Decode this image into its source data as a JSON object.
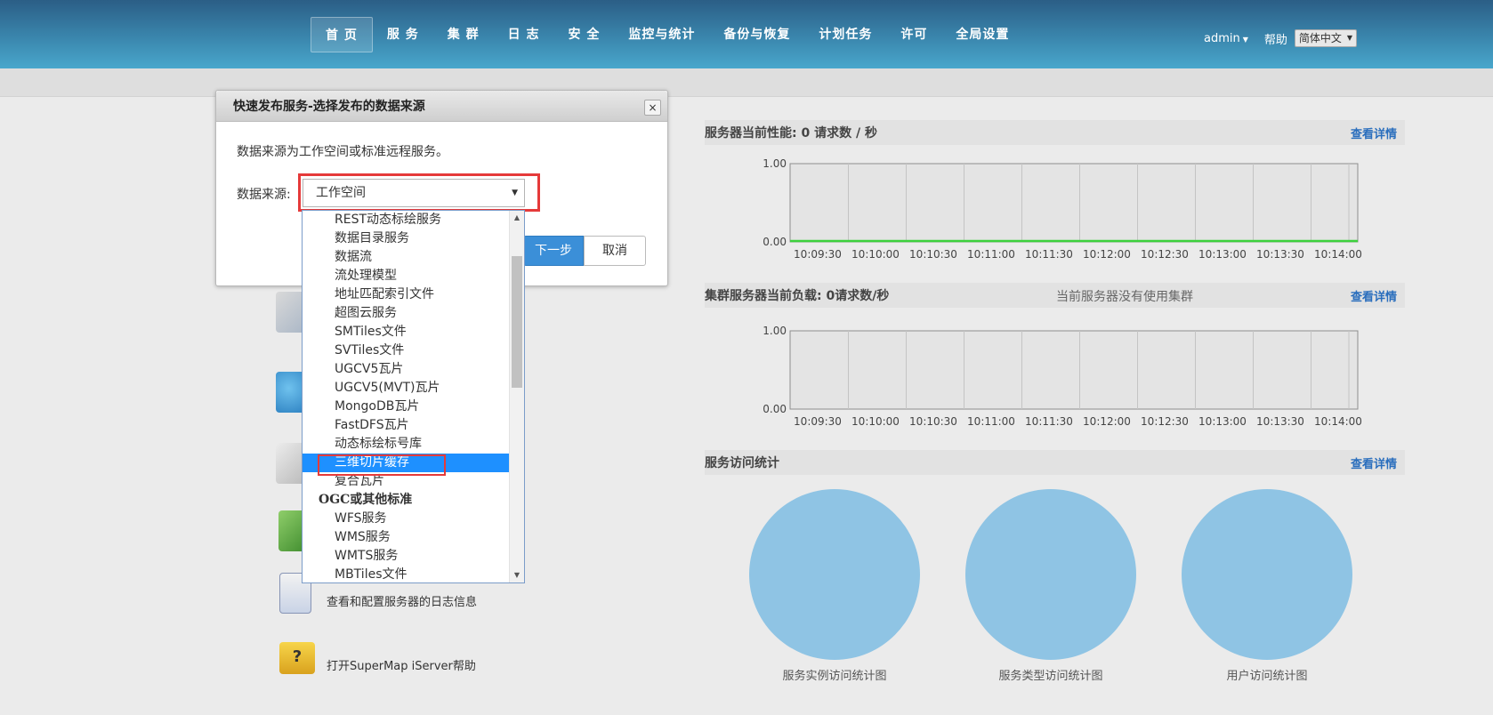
{
  "nav": {
    "items": [
      "首 页",
      "服 务",
      "集 群",
      "日 志",
      "安 全",
      "监控与统计",
      "备份与恢复",
      "计划任务",
      "许可",
      "全局设置"
    ],
    "active_index": 0
  },
  "user": {
    "name": "admin",
    "help": "帮助",
    "language": "简体中文"
  },
  "modal": {
    "title": "快速发布服务-选择发布的数据来源",
    "close_glyph": "×",
    "description": "数据来源为工作空间或标准远程服务。",
    "source_label": "数据来源:",
    "source_value": "工作空间",
    "next_label": "下一步",
    "cancel_label": "取消",
    "highlight_color": "#e53a3a"
  },
  "dropdown": {
    "items": [
      {
        "label": "REST动态标绘服务",
        "type": "item"
      },
      {
        "label": "数据目录服务",
        "type": "item"
      },
      {
        "label": "数据流",
        "type": "item"
      },
      {
        "label": "流处理模型",
        "type": "item"
      },
      {
        "label": "地址匹配索引文件",
        "type": "item"
      },
      {
        "label": "超图云服务",
        "type": "item"
      },
      {
        "label": "SMTiles文件",
        "type": "item"
      },
      {
        "label": "SVTiles文件",
        "type": "item"
      },
      {
        "label": "UGCV5瓦片",
        "type": "item"
      },
      {
        "label": "UGCV5(MVT)瓦片",
        "type": "item"
      },
      {
        "label": "MongoDB瓦片",
        "type": "item"
      },
      {
        "label": "FastDFS瓦片",
        "type": "item"
      },
      {
        "label": "动态标绘标号库",
        "type": "item"
      },
      {
        "label": "三维切片缓存",
        "type": "item",
        "selected": true
      },
      {
        "label": "复合瓦片",
        "type": "item"
      },
      {
        "label": "OGC或其他标准",
        "type": "group"
      },
      {
        "label": "WFS服务",
        "type": "item"
      },
      {
        "label": "WMS服务",
        "type": "item"
      },
      {
        "label": "WMTS服务",
        "type": "item"
      },
      {
        "label": "MBTiles文件",
        "type": "item"
      }
    ],
    "selected_color": "#1e90ff"
  },
  "quick_links": [
    {
      "text": "查看和配置服务器的日志信息",
      "icon": "log-document-icon"
    },
    {
      "text": "打开SuperMap iServer帮助",
      "icon": "help-folder-icon"
    }
  ],
  "panels": {
    "performance": {
      "title": "服务器当前性能:  0 请求数 / 秒",
      "link": "查看详情"
    },
    "cluster": {
      "title": "集群服务器当前负载:  0请求数/秒",
      "note": "当前服务器没有使用集群",
      "link": "查看详情"
    },
    "stats": {
      "title": "服务访问统计",
      "link": "查看详情",
      "pies": [
        "服务实例访问统计图",
        "服务类型访问统计图",
        "用户访问统计图"
      ],
      "pie_color": "#8fc4e4"
    }
  },
  "chart_data": [
    {
      "type": "line",
      "x": [
        "10:09:30",
        "10:10:00",
        "10:10:30",
        "10:11:00",
        "10:11:30",
        "10:12:00",
        "10:12:30",
        "10:13:00",
        "10:13:30",
        "10:14:00"
      ],
      "y_ticks": [
        "1.00",
        "0.00"
      ],
      "ylim": [
        0,
        1
      ],
      "series": [
        {
          "values": [
            0,
            0,
            0,
            0,
            0,
            0,
            0,
            0,
            0,
            0
          ],
          "color": "#3cd13c"
        }
      ]
    },
    {
      "type": "line",
      "x": [
        "10:09:30",
        "10:10:00",
        "10:10:30",
        "10:11:00",
        "10:11:30",
        "10:12:00",
        "10:12:30",
        "10:13:00",
        "10:13:30",
        "10:14:00"
      ],
      "y_ticks": [
        "1.00",
        "0.00"
      ],
      "ylim": [
        0,
        1
      ],
      "series": []
    }
  ]
}
